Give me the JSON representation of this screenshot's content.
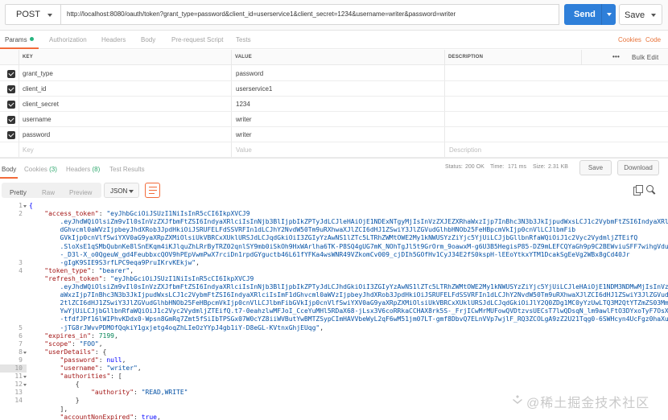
{
  "request": {
    "method": "POST",
    "url": "http://localhost:8080/oauth/token?grant_type=password&client_id=userservice1&client_secret=1234&username=writer&password=writer",
    "send_label": "Send",
    "save_label": "Save"
  },
  "req_tabs": [
    "Params",
    "Authorization",
    "Headers",
    "Body",
    "Pre-request Script",
    "Tests"
  ],
  "req_links": {
    "cookies": "Cookies",
    "code": "Code"
  },
  "params": {
    "headers": {
      "key": "KEY",
      "value": "VALUE",
      "description": "DESCRIPTION"
    },
    "more": "•••",
    "bulk_edit": "Bulk Edit",
    "rows": [
      {
        "key": "grant_type",
        "value": "password"
      },
      {
        "key": "client_id",
        "value": "userservice1"
      },
      {
        "key": "client_secret",
        "value": "1234"
      },
      {
        "key": "username",
        "value": "writer"
      },
      {
        "key": "password",
        "value": "writer"
      }
    ],
    "placeholders": {
      "key": "Key",
      "value": "Value",
      "description": "Description"
    }
  },
  "resp_tabs": {
    "body": "Body",
    "cookies": "Cookies",
    "cookies_count": "(3)",
    "headers": "Headers",
    "headers_count": "(8)",
    "tests": "Test Results"
  },
  "resp_status": {
    "status_label": "Status:",
    "status": "200 OK",
    "time_label": "Time:",
    "time": "171 ms",
    "size_label": "Size:",
    "size": "2.31 KB"
  },
  "resp_buttons": {
    "save": "Save",
    "download": "Download"
  },
  "view": {
    "pretty": "Pretty",
    "raw": "Raw",
    "preview": "Preview",
    "format": "JSON"
  },
  "code": {
    "line_numbers": [
      "1",
      "2",
      "",
      "",
      "",
      "",
      "",
      "3",
      "4",
      "",
      "",
      "",
      "",
      "",
      "",
      "5",
      "6",
      "7",
      "8",
      "9",
      "10",
      "11",
      "12",
      "13",
      "14",
      ""
    ],
    "lines": [
      [
        [
          "b",
          "{"
        ]
      ],
      [
        [
          "p",
          "    "
        ],
        [
          "k",
          "\"access_token\""
        ],
        [
          "p",
          ": "
        ],
        [
          "s",
          "\"eyJhbGciOiJSUzI1NiIsInR5cCI6IkpXVCJ9"
        ]
      ],
      [
        [
          "s",
          "        .eyJhdWQiOlsiZm9vIl0sInVzZXJfbmFtZSI6IndyaXRlciIsInNjb3BlIjpbIkZPTyJdLCJleHAiOjE1NDExNTgyMjIsInVzZXJEZXRhaWxzIjp7InBhc3N3b3JkIjpudWxsLCJ1c2VybmFtZSI6IndyaXRlciIsImF1"
        ]
      ],
      [
        [
          "s",
          "        dGhvcml0aWVzIjpbeyJhdXRob3JpdHkiOiJSRUFELFdSSVRFIn1dLCJhY2NvdW50Tm9uRXhwaXJlZCI6dHJ1ZSwiY3JlZGVudGlhbHNOb25FeHBpcmVkIjp0cnVlLCJlbmFib"
        ]
      ],
      [
        [
          "s",
          "        GVkIjp0cnVlfSwiYXV0aG9yaXRpZXMiOlsiUkVBRCxXUklURSJdLCJqdGkiOiI3ZGIyYzAwNS1lZTc5LTRhZWMtOWE2My1kNWUSYzZiYjc5YjUiLCJjbGllbnRfaWQiOiJ1c2Vyc2VydmljZTEifQ"
        ]
      ],
      [
        [
          "s",
          "        .SloXsE1qSMbQubnKe8lSnEKqm4iKJlquZhLRrByTRZ02qnlSY9mb0iSkOh9HxWArlha6TK-P8SQ4gUG7mK_NOhTgJl5t9GrOrm_9oawxM-g6U3B5HegisP85-DZ9mLEFCQYaGh9p9C2BEWviuSFF7wihgVdu7aO"
        ]
      ],
      [
        [
          "s",
          "        -_D3l-X_o0QgeuW_gd4FeubbxcQOV9hPEpVwmPwX7rciDn1rpdGYguctb46L61fYFKa4wsWNR49VZkomCv009_cjDIh5GOfHv1CyJ34E2fS0kspH-lEEoYtkxYTM1DcakSgEeVg2WBx8gCd40Jr"
        ]
      ],
      [
        [
          "s",
          "        -gIgK9SIE9S3rfLPC9eqa9PruIKrvKEkjw\""
        ],
        [
          "p",
          ","
        ]
      ],
      [
        [
          "p",
          "    "
        ],
        [
          "k",
          "\"token_type\""
        ],
        [
          "p",
          ": "
        ],
        [
          "s",
          "\"bearer\""
        ],
        [
          "p",
          ","
        ]
      ],
      [
        [
          "p",
          "    "
        ],
        [
          "k",
          "\"refresh_token\""
        ],
        [
          "p",
          ": "
        ],
        [
          "s",
          "\"eyJhbGciOiJSUzI1NiIsInR5cCI6IkpXVCJ9"
        ]
      ],
      [
        [
          "s",
          "        .eyJhdWQiOlsiZm9vIl0sInVzZXJfbmFtZSI6IndyaXRlciIsInNjb3BlIjpbIkZPTyJdLCJhdGkiOiI3ZGIyYzAwNS1lZTc5LTRhZWMtOWE2My1kNWUSYzZiYjc5YjUiLCJleHAiOjE1NDM3NDMwMjIsInVzZXJEZXRh"
        ]
      ],
      [
        [
          "s",
          "        aWxzIjp7InBhc3N3b3JkIjpudWxsLCJ1c2VybmFtZSI6IndyaXRlciIsImF1dGhvcml0aWVzIjpbeyJhdXRob3JpdHkiOiJSRUFELFdSSVRFIn1dLCJhY2NvdW50Tm9uRXhwaXJlZCI6dHJ1ZSwiY3JlZGVudGlhbHNOb25FeHBpcmVkIjp0cnVlLCJlbmFib"
        ]
      ],
      [
        [
          "s",
          "        2tlZCI6dHJ1ZSwiY3JlZGVudGlhbHNOb25FeHBpcmVkIjp0cnVlLCJlbmFibGVkIjp0cnVlfSwiYXV0aG9yaXRpZXMiOlsiUkVBRCxXUklURSJdLCJqdGkiOiJlY2Q0ZDg1MC0yYzUwLTQ3M2QtYTZmZS03MmQwMjg2YW"
        ]
      ],
      [
        [
          "s",
          "        YwYjUiLCJjbGllbnRfaWQiOiJ1c2Vyc2VydmljZTEifQ.t7-0eahzlwMFJoI_CceYuMHl5RDaX68-jLsx3V6coRRkaCCHAX8rk5S-_FrjICwMrMUFowQVDtzvsUECsT7lwQDsqN_lm9awlFtO3DYxoTyF7OsXo"
        ]
      ],
      [
        [
          "s",
          "        -tfdfJPf16lWIPhvKDdx0-Wpsn8GmRq7Zmt5fSiIbTPSGx07W0cYZ8iiWVButYwBMTZSypCImHAVVbeWyL2qF6wM51jm07LT-gmf8DbvQ7ELnVVp7wjlF_RQ3ZCOLgA9zZ2U21Tqg0-6SWHcyn4UcFgz0haXuJue2n"
        ]
      ],
      [
        [
          "s",
          "        -jTG8rJWvvPDMOfQqkiY1gxjetg4oqZhLIeOzYYpJ4gb1iY-D8eGL-KVtnxGhjEUqg\""
        ],
        [
          "p",
          ","
        ]
      ],
      [
        [
          "p",
          "    "
        ],
        [
          "k",
          "\"expires_in\""
        ],
        [
          "p",
          ": "
        ],
        [
          "n",
          "7199"
        ],
        [
          "p",
          ","
        ]
      ],
      [
        [
          "p",
          "    "
        ],
        [
          "k",
          "\"scope\""
        ],
        [
          "p",
          ": "
        ],
        [
          "s",
          "\"FOO\""
        ],
        [
          "p",
          ","
        ]
      ],
      [
        [
          "p",
          "    "
        ],
        [
          "k",
          "\"userDetails\""
        ],
        [
          "p",
          ": {"
        ]
      ],
      [
        [
          "p",
          "        "
        ],
        [
          "k",
          "\"password\""
        ],
        [
          "p",
          ": "
        ],
        [
          "b",
          "null"
        ],
        [
          "p",
          ","
        ]
      ],
      [
        [
          "p",
          "        "
        ],
        [
          "k",
          "\"username\""
        ],
        [
          "p",
          ": "
        ],
        [
          "s",
          "\"writer\""
        ],
        [
          "p",
          ","
        ]
      ],
      [
        [
          "p",
          "        "
        ],
        [
          "k",
          "\"authorities\""
        ],
        [
          "p",
          ": ["
        ]
      ],
      [
        [
          "p",
          "            {"
        ]
      ],
      [
        [
          "p",
          "                "
        ],
        [
          "k",
          "\"authority\""
        ],
        [
          "p",
          ": "
        ],
        [
          "s",
          "\"READ,WRITE\""
        ]
      ],
      [
        [
          "p",
          "            }"
        ]
      ],
      [
        [
          "p",
          "        ],"
        ]
      ],
      [
        [
          "p",
          "        "
        ],
        [
          "k",
          "\"accountNonExpired\""
        ],
        [
          "p",
          ": "
        ],
        [
          "b",
          "true"
        ],
        [
          "p",
          ","
        ]
      ]
    ]
  },
  "watermark": "@稀土掘金技术社区"
}
